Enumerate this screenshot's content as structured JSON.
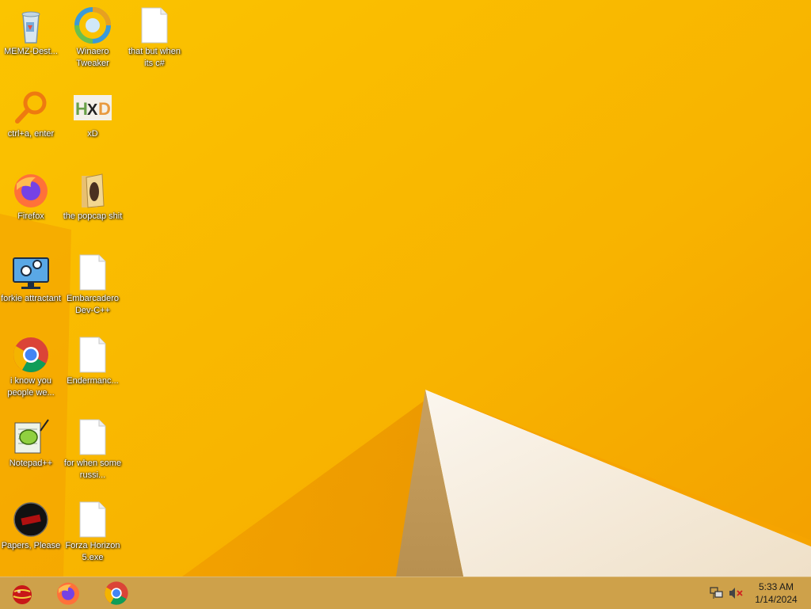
{
  "desktop": {
    "icons": [
      {
        "label": "MEMZ-Dest...",
        "icon": "recycle-bin-icon"
      },
      {
        "label": "Winaero Tweaker",
        "icon": "winaero-icon"
      },
      {
        "label": "that but when its c#",
        "icon": "blank-file-icon"
      },
      {
        "label": "ctrl+a, enter",
        "icon": "magnifier-icon"
      },
      {
        "label": "xD",
        "icon": "hxd-icon"
      },
      {
        "label": "Firefox",
        "icon": "firefox-icon"
      },
      {
        "label": "the popcap shit",
        "icon": "folder-icon"
      },
      {
        "label": "forkie attractant",
        "icon": "settings-monitor-icon"
      },
      {
        "label": "Embarcadero Dev-C++",
        "icon": "blank-file-icon"
      },
      {
        "label": "i know you people we...",
        "icon": "chrome-icon"
      },
      {
        "label": "Endermanc...",
        "icon": "blank-file-icon"
      },
      {
        "label": "Notepad++",
        "icon": "notepadpp-icon"
      },
      {
        "label": "for when some russi...",
        "icon": "blank-file-icon"
      },
      {
        "label": "Papers, Please",
        "icon": "papers-please-icon"
      },
      {
        "label": "Forza Horizon 5.exe",
        "icon": "blank-file-icon"
      }
    ]
  },
  "taskbar": {
    "pinned": [
      {
        "name": "ornament-app",
        "icon": "ornament-icon"
      },
      {
        "name": "Firefox",
        "icon": "firefox-icon"
      },
      {
        "name": "Chrome",
        "icon": "chrome-icon"
      }
    ],
    "clock": {
      "time": "5:33 AM",
      "date": "1/14/2024"
    }
  },
  "colors": {
    "wallpaper": "#f7b600",
    "taskbar": "#caa050"
  }
}
